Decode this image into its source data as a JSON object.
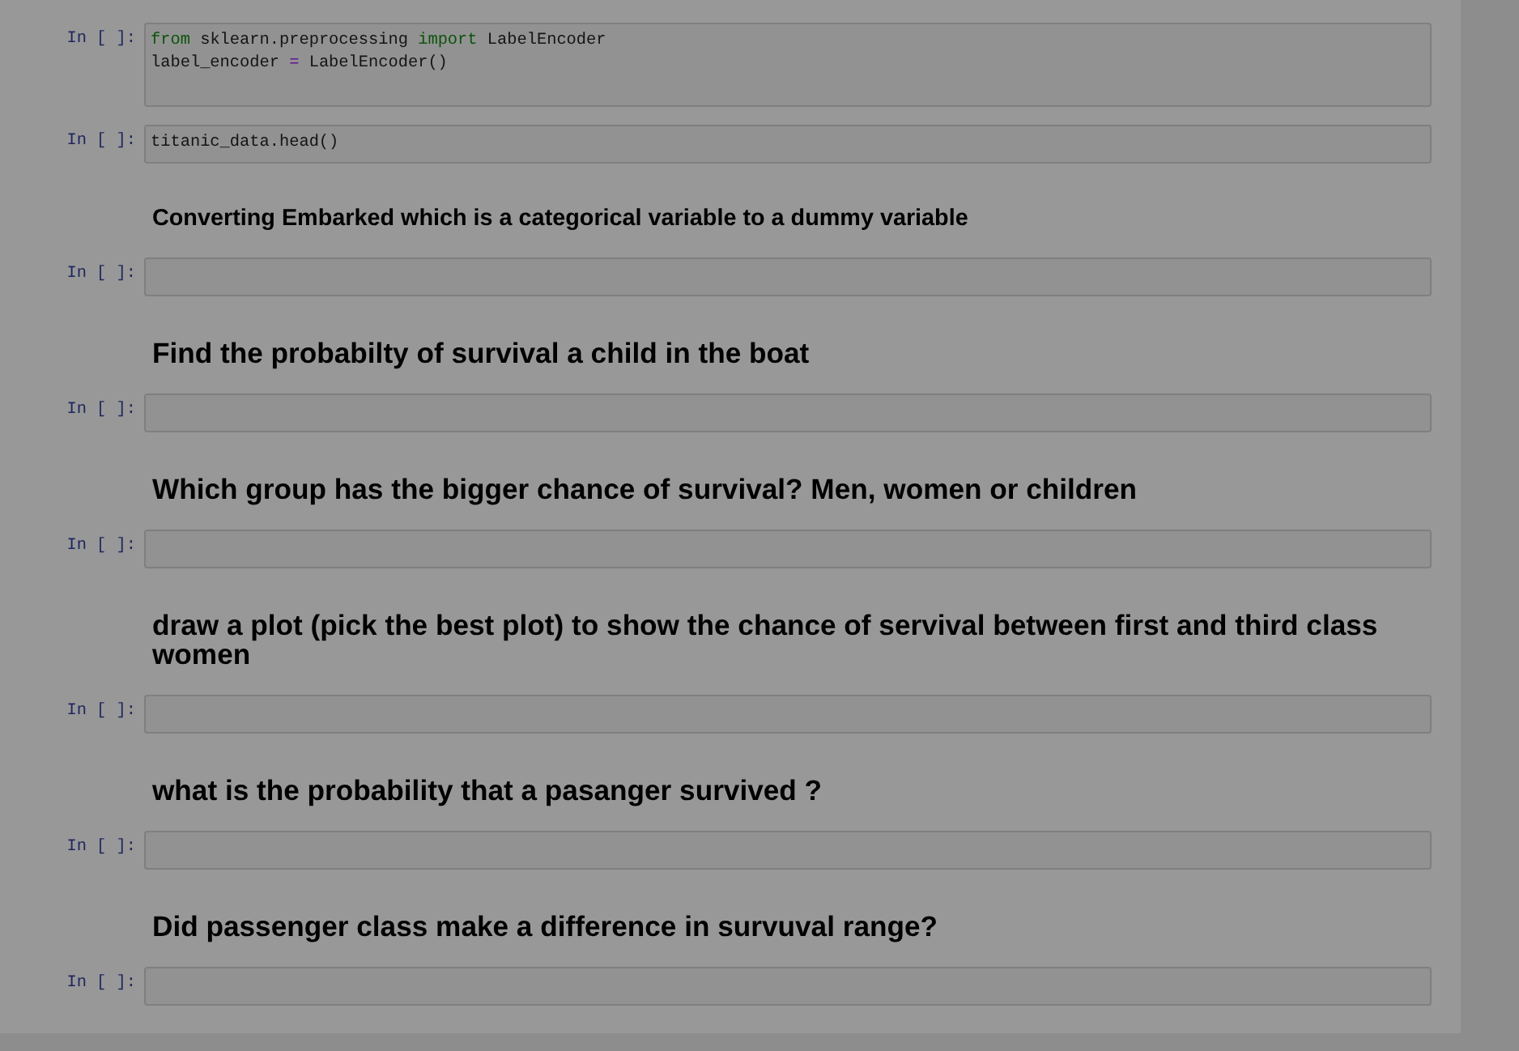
{
  "notebook": {
    "cells": [
      {
        "kind": "code",
        "prompt": "In [ ]:",
        "trailing_blank_line": true,
        "lines": [
          [
            {
              "text": "from",
              "kind": "keyword"
            },
            {
              "text": " sklearn.preprocessing ",
              "kind": "plain"
            },
            {
              "text": "import",
              "kind": "keyword"
            },
            {
              "text": " LabelEncoder",
              "kind": "plain"
            }
          ],
          [
            {
              "text": "label_encoder ",
              "kind": "plain"
            },
            {
              "text": "=",
              "kind": "operator"
            },
            {
              "text": " LabelEncoder()",
              "kind": "plain"
            }
          ]
        ]
      },
      {
        "kind": "code",
        "prompt": "In [ ]:",
        "lines": [
          [
            {
              "text": "titanic_data.head()",
              "kind": "plain"
            }
          ]
        ]
      },
      {
        "kind": "subheading",
        "text": "Converting Embarked which is a categorical variable to a dummy variable"
      },
      {
        "kind": "code",
        "prompt": "In [ ]:"
      },
      {
        "kind": "heading",
        "text": "Find the probabilty of survival a child in the boat"
      },
      {
        "kind": "code",
        "prompt": "In [ ]:"
      },
      {
        "kind": "heading",
        "text": "Which group has the bigger chance of survival? Men, women or children"
      },
      {
        "kind": "code",
        "prompt": "In [ ]:"
      },
      {
        "kind": "heading",
        "text": "draw a plot (pick the best plot) to show the chance of servival between first and third class women"
      },
      {
        "kind": "code",
        "prompt": "In [ ]:"
      },
      {
        "kind": "heading",
        "text": "what is the probability that a pasanger survived ?"
      },
      {
        "kind": "code",
        "prompt": "In [ ]:"
      },
      {
        "kind": "heading",
        "text": "Did passenger class make a difference in survuval range?"
      },
      {
        "kind": "code",
        "prompt": "In [ ]:"
      }
    ]
  }
}
